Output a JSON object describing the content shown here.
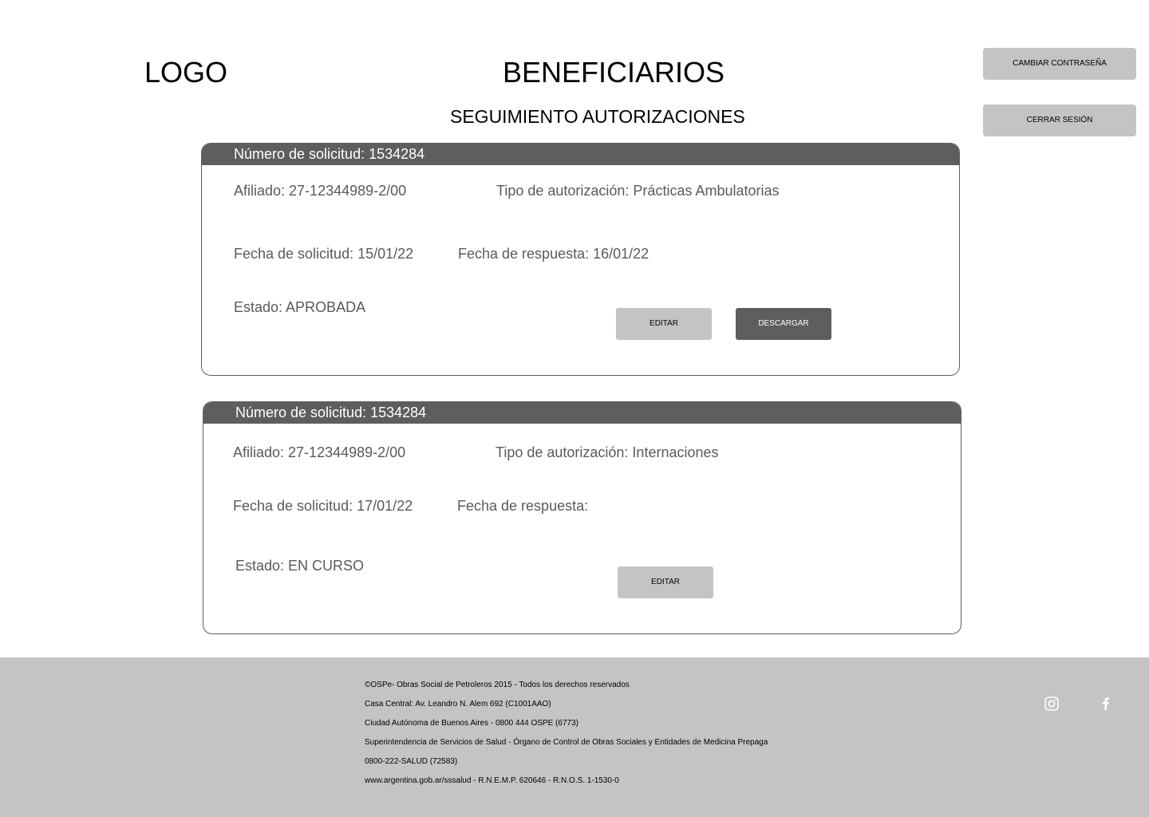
{
  "header": {
    "logo": "LOGO",
    "title": "BENEFICIARIOS",
    "subtitle": "SEGUIMIENTO AUTORIZACIONES",
    "change_password_label": "CAMBIAR CONTRASEÑA",
    "logout_label": "CERRAR SESIÓN"
  },
  "requests": [
    {
      "number": "Número de solicitud: 1534284",
      "affiliate": "Afiliado: 27-12344989-2/00",
      "auth_type": "Tipo de autorización: Prácticas Ambulatorias",
      "request_date": "Fecha de solicitud: 15/01/22",
      "response_date": "Fecha de respuesta: 16/01/22",
      "status": "Estado: APROBADA",
      "edit_label": "EDITAR",
      "download_label": "DESCARGAR"
    },
    {
      "number": "Número de solicitud: 1534284",
      "affiliate": "Afiliado: 27-12344989-2/00",
      "auth_type": "Tipo de autorización: Internaciones",
      "request_date": "Fecha de solicitud: 17/01/22",
      "response_date": "Fecha de respuesta:",
      "status": "Estado: EN CURSO",
      "edit_label": "EDITAR"
    }
  ],
  "footer": {
    "lines": [
      "©OSPe- Obras Social de Petroleros 2015 - Todos los derechos reservados",
      "Casa Central: Av. Leandro N. Alem 692 (C1001AAO)",
      "Ciudad Autónoma de Buenos Aires - 0800 444 OSPE (6773)",
      "Superintendencia de Servicios de Salud - Órgano de Control de Obras Sociales y Entidades de Medicina Prepaga",
      "0800-222-SALUD (72583)",
      "www.argentina.gob.ar/sssalud - R.N.E.M.P. 620646 - R.N.O.S. 1-1530-0"
    ],
    "social_icons": [
      "instagram-icon",
      "facebook-icon"
    ]
  },
  "colors": {
    "header_bar": "#5e5e5e",
    "button_light": "#c4c4c4",
    "footer_bg": "#c4c4c4",
    "text_gray": "#5a5a5a"
  }
}
